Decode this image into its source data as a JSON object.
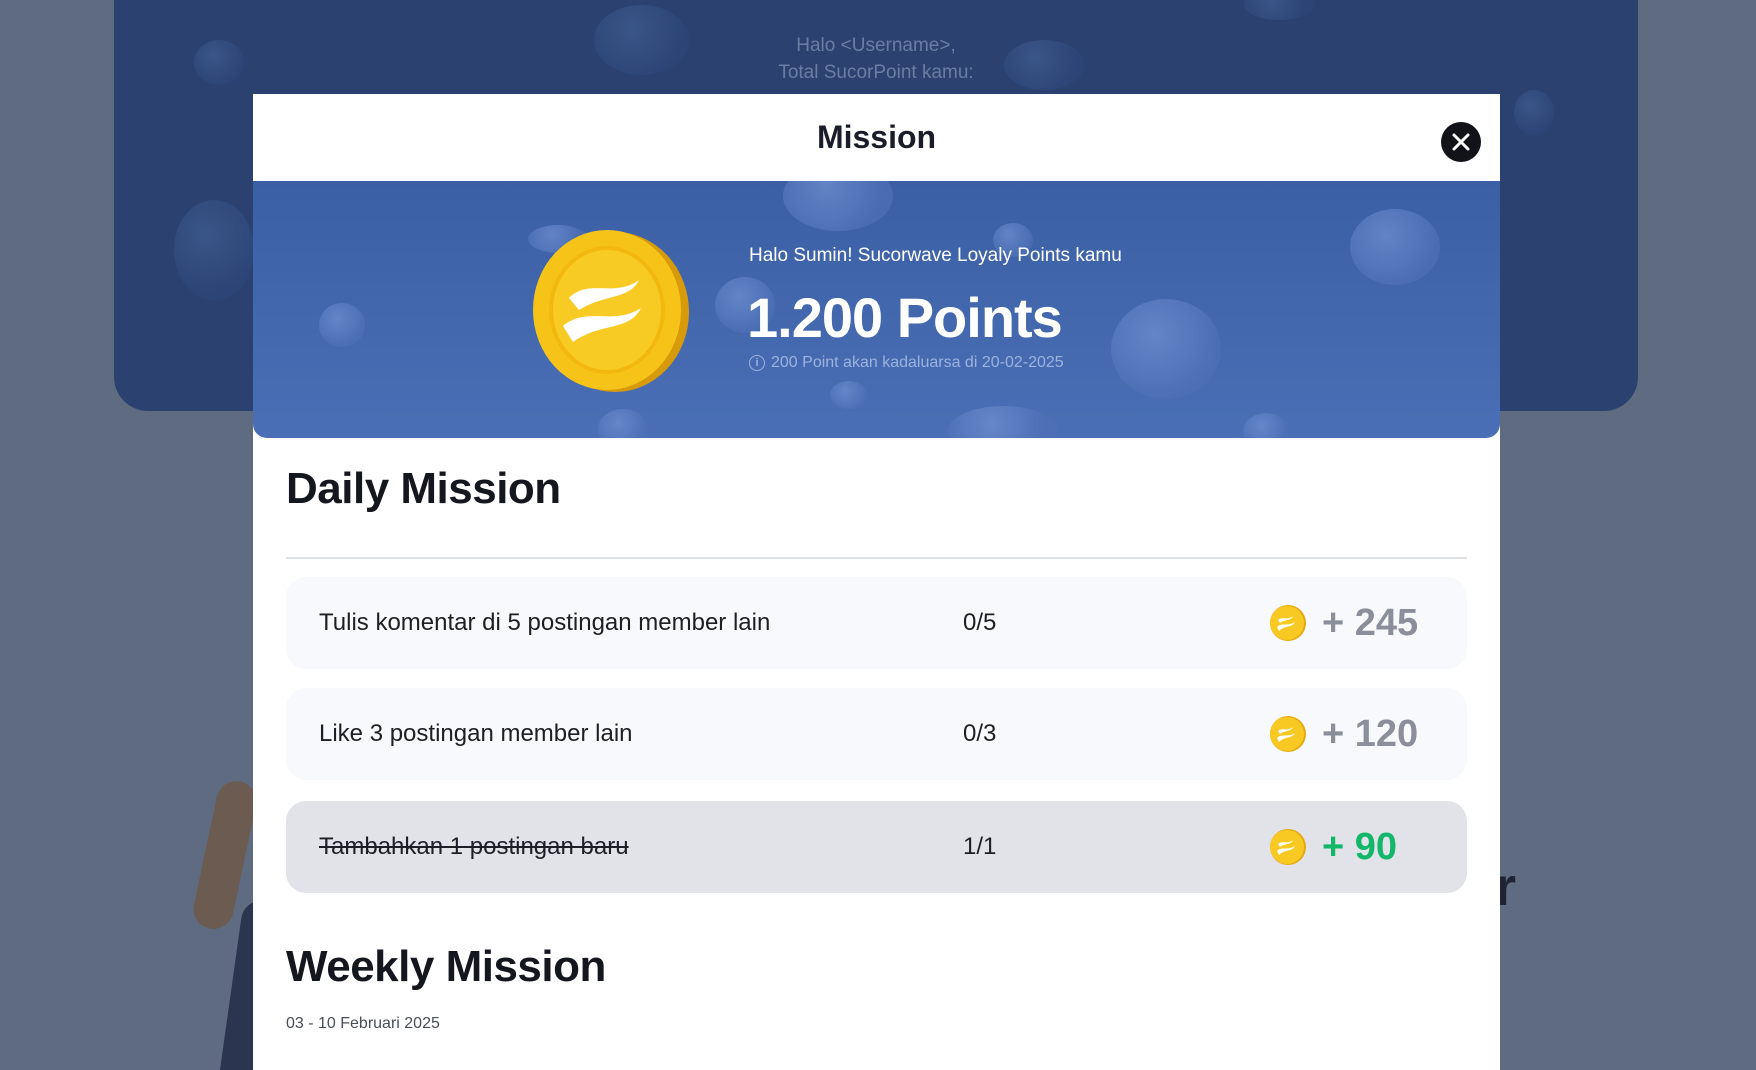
{
  "background": {
    "greeting_line1": "Halo <Username>,",
    "greeting_line2": "Total SucorPoint kamu:",
    "partial_letter": "r"
  },
  "modal": {
    "title": "Mission",
    "close_icon": "close-icon"
  },
  "banner": {
    "greeting": "Halo Sumin! Sucorwave Loyaly Points kamu",
    "points": "1.200 Points",
    "expiry": "200 Point akan kadaluarsa di 20-02-2025",
    "info_icon": "info-icon",
    "coin_icon": "sucorwave-coin-icon"
  },
  "daily": {
    "title": "Daily Mission",
    "missions": [
      {
        "name": "Tulis komentar di 5 postingan member lain",
        "progress": "0/5",
        "reward": "+ 245",
        "completed": false
      },
      {
        "name": "Like 3 postingan member lain",
        "progress": "0/3",
        "reward": "+ 120",
        "completed": false
      },
      {
        "name": "Tambahkan 1 postingan baru",
        "progress": "1/1",
        "reward": "+ 90",
        "completed": true
      }
    ]
  },
  "weekly": {
    "title": "Weekly Mission",
    "date_range": "03 - 10 Februari 2025"
  },
  "colors": {
    "banner_blue": "#3b5fa4",
    "coin_gold": "#f5c20f",
    "reward_pending": "#8a8f9b",
    "reward_done": "#12b76a",
    "completed_row": "#e1e3e9"
  }
}
